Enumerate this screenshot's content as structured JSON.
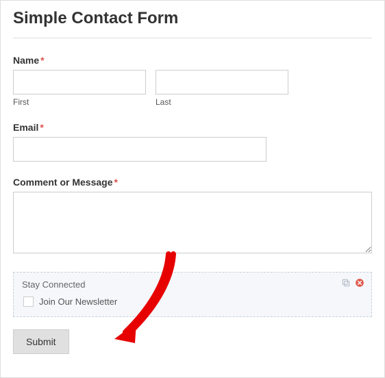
{
  "title": "Simple Contact Form",
  "name": {
    "label": "Name",
    "required": "*",
    "first_sublabel": "First",
    "last_sublabel": "Last"
  },
  "email": {
    "label": "Email",
    "required": "*"
  },
  "comment": {
    "label": "Comment or Message",
    "required": "*"
  },
  "newsletter": {
    "block_title": "Stay Connected",
    "checkbox_label": "Join Our Newsletter"
  },
  "submit_label": "Submit"
}
